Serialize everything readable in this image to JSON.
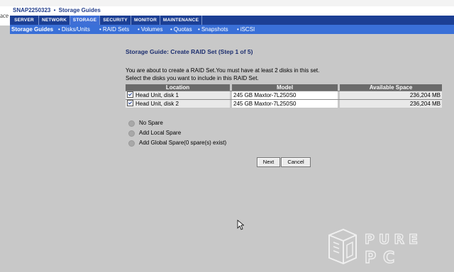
{
  "browser_left_fragment": "ace",
  "header": {
    "system_name": "SNAP2250323",
    "separator": "•",
    "section": "Storage Guides"
  },
  "nav": {
    "tabs": [
      {
        "label": "SERVER"
      },
      {
        "label": "NETWORK"
      },
      {
        "label": "STORAGE",
        "active": true
      },
      {
        "label": "SECURITY"
      },
      {
        "label": "MONITOR"
      },
      {
        "label": "MAINTENANCE"
      }
    ]
  },
  "subnav": {
    "items": [
      {
        "label": "Storage Guides",
        "active": true
      },
      {
        "label": "Disks/Units"
      },
      {
        "label": "RAID Sets"
      },
      {
        "label": "Volumes"
      },
      {
        "label": "Quotas"
      },
      {
        "label": "Snapshots"
      },
      {
        "label": "iSCSI"
      }
    ],
    "bullet": "•"
  },
  "main": {
    "title": "Storage Guide: Create RAID Set (Step 1 of 5)",
    "intro_line1": "You are about to create a RAID Set.You must have at least 2 disks in this set.",
    "intro_line2": "Select the disks you want to include in this RAID Set.",
    "table": {
      "headers": {
        "location": "Location",
        "model": "Model",
        "space": "Available Space"
      },
      "rows": [
        {
          "location": "Head Unit, disk 1",
          "model": "245 GB Maxtor-7L250S0",
          "space": "236,204 MB",
          "checked": true
        },
        {
          "location": "Head Unit, disk 2",
          "model": "245 GB Maxtor-7L250S0",
          "space": "236,204 MB",
          "checked": true
        }
      ]
    },
    "spare_options": [
      {
        "label": "No Spare"
      },
      {
        "label": "Add Local Spare"
      },
      {
        "label": "Add Global Spare(0 spare(s) exist)"
      }
    ],
    "buttons": {
      "next": "Next",
      "cancel": "Cancel"
    }
  },
  "watermark": {
    "line1": "PURE",
    "line2": "PC"
  },
  "colors": {
    "nav_bg": "#1c3f94",
    "subnav_bg": "#3a70d8",
    "page_bg": "#c8c8c8",
    "title": "#1c2e6f"
  }
}
